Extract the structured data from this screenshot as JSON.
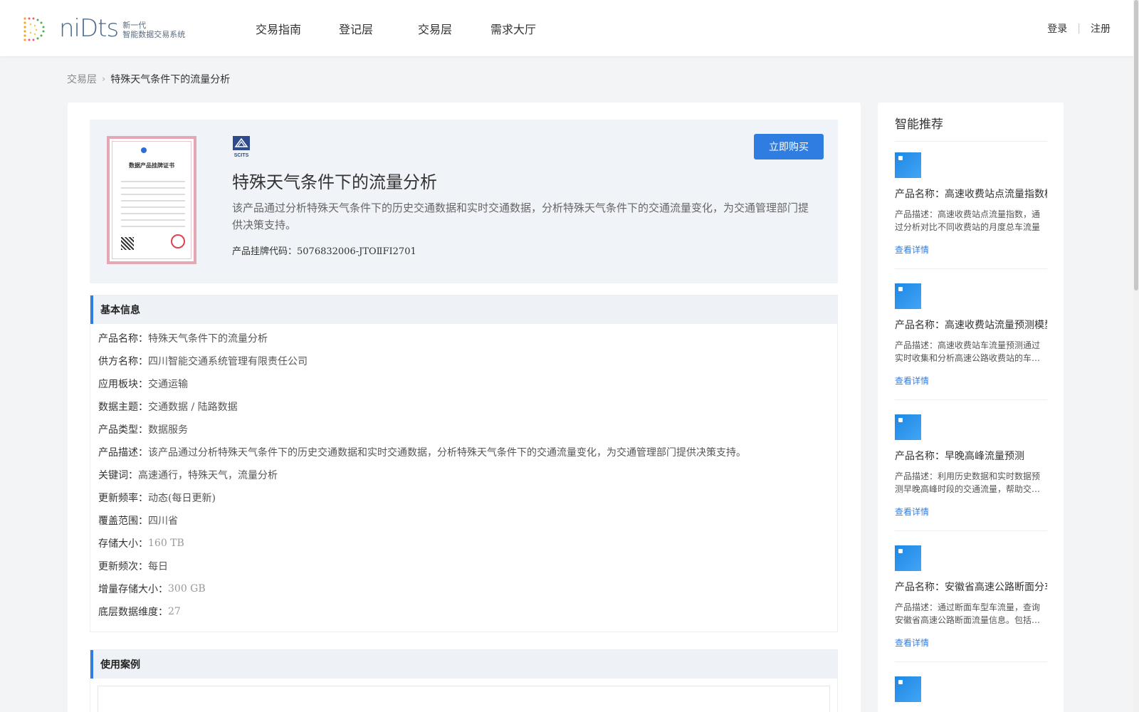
{
  "header": {
    "logo_word": "niDts",
    "logo_sub_line1": "新一代",
    "logo_sub_line2": "智能数据交易系统",
    "nav": [
      "交易指南",
      "登记层",
      "交易层",
      "需求大厅"
    ],
    "login": "登录",
    "register": "注册"
  },
  "breadcrumb": {
    "parent": "交易层",
    "current": "特殊天气条件下的流量分析"
  },
  "product": {
    "title": "特殊天气条件下的流量分析",
    "description": "该产品通过分析特殊天气条件下的历史交通数据和实时交通数据，分析特殊天气条件下的交通流量变化，为交通管理部门提供决策支持。",
    "code_label": "产品挂牌代码：",
    "code_value": "5076832006-JTOⅡFI2701",
    "buy_label": "立即购买",
    "cert_title": "数据产品挂牌证书",
    "logo_text": "SCITS"
  },
  "basic_info": {
    "heading": "基本信息",
    "rows": [
      {
        "label": "产品名称：",
        "value": "特殊天气条件下的流量分析"
      },
      {
        "label": "供方名称：",
        "value": "四川智能交通系统管理有限责任公司"
      },
      {
        "label": "应用板块：",
        "value": "交通运输"
      },
      {
        "label": "数据主题：",
        "value": "交通数据 / 陆路数据"
      },
      {
        "label": "产品类型：",
        "value": "数据服务"
      },
      {
        "label": "产品描述：",
        "value": "该产品通过分析特殊天气条件下的历史交通数据和实时交通数据，分析特殊天气条件下的交通流量变化，为交通管理部门提供决策支持。"
      },
      {
        "label": "关键词：",
        "value": "高速通行，特殊天气，流量分析"
      },
      {
        "label": "更新频率：",
        "value": "动态(每日更新)"
      },
      {
        "label": "覆盖范围：",
        "value": "四川省"
      },
      {
        "label": "存储大小：",
        "value": "160 TB"
      },
      {
        "label": "更新频次：",
        "value": "每日"
      },
      {
        "label": "增量存储大小：",
        "value": "300 GB"
      },
      {
        "label": "底层数据维度：",
        "value": "27"
      }
    ]
  },
  "use_cases": {
    "heading": "使用案例"
  },
  "sidebar": {
    "title": "智能推荐",
    "link_label": "查看详情",
    "items": [
      {
        "name": "产品名称：高速收费站点流量指数模型",
        "desc": "产品描述：高速收费站点流量指数，通过分析对比不同收费站的月度总车流量"
      },
      {
        "name": "产品名称：高速收费站流量预测模型",
        "desc": "产品描述：高速收费站车流量预测通过实时收集和分析高速公路收费站的车流量"
      },
      {
        "name": "产品名称：早晚高峰流量预测",
        "desc": "产品描述：利用历史数据和实时数据预测早晚高峰时段的交通流量，帮助交通管理"
      },
      {
        "name": "产品名称：安徽省高速公路断面分车型流量",
        "desc": "产品描述：通过断面车型车流量，查询安徽省高速公路断面流量信息。包括各车型"
      }
    ]
  }
}
